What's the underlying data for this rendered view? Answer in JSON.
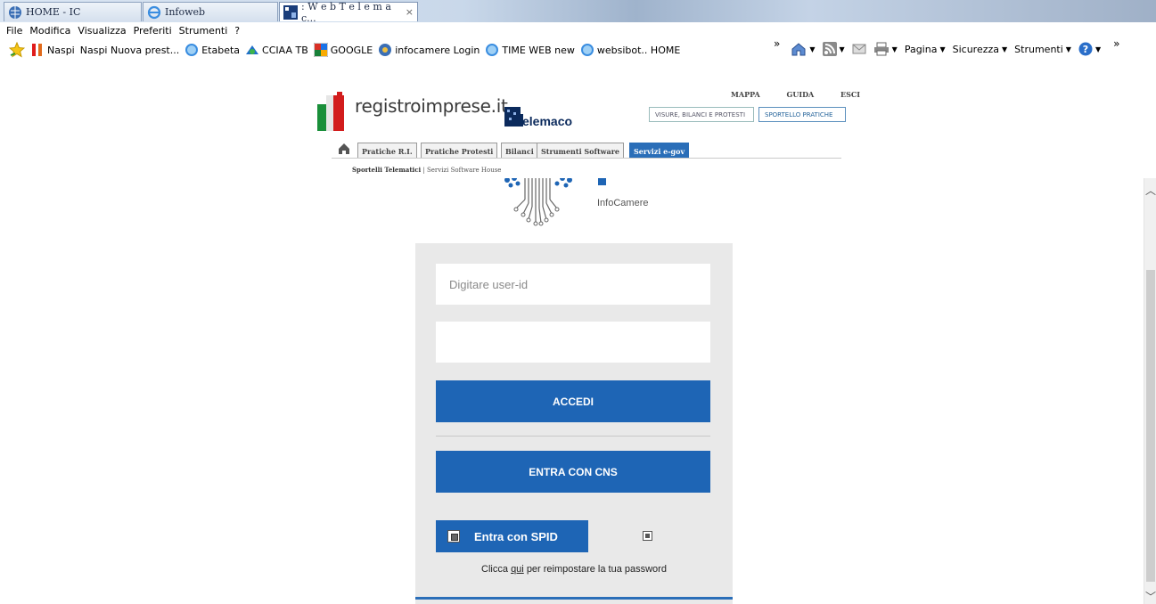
{
  "browser": {
    "tabs": [
      {
        "title": "HOME - IC",
        "active": false
      },
      {
        "title": "Infoweb",
        "active": false
      },
      {
        "title": ": W e b T e l e m a c...",
        "active": true
      }
    ],
    "tab_close": "×",
    "menu": [
      "File",
      "Modifica",
      "Visualizza",
      "Preferiti",
      "Strumenti",
      "?"
    ],
    "favorites": [
      "Naspi",
      "Naspi Nuova prest...",
      "Etabeta",
      "CCIAA TB",
      "GOOGLE",
      "infocamere Login",
      "TIME WEB new",
      "websibot.. HOME"
    ],
    "chevron": "»",
    "commands": {
      "page": "Pagina",
      "security": "Sicurezza",
      "tools": "Strumenti"
    }
  },
  "site": {
    "logo_text": "registroimprese.it",
    "telemaco_text": "elemaco",
    "top_links": [
      "MAPPA",
      "GUIDA",
      "ESCI"
    ],
    "switch": [
      "VISURE, BILANCI E PROTESTI",
      "SPORTELLO PRATICHE"
    ],
    "nav_tabs": [
      "Pratiche R.I.",
      "Pratiche Protesti",
      "Bilanci",
      "Strumenti Software",
      "Servizi e-gov"
    ],
    "subnav_primary": "Sportelli Telematici",
    "subnav_sep": "|",
    "subnav_secondary": "Servizi Software House"
  },
  "login": {
    "brand_text": "InfoCamere",
    "userid_placeholder": "Digitare user-id",
    "password_value": "",
    "accedi_label": "ACCEDI",
    "cns_label": "ENTRA CON CNS",
    "spid_label": "Entra con SPID",
    "reset_prefix": "Clicca",
    "reset_link": "qui",
    "reset_suffix": "per reimpostare la tua password"
  },
  "colors": {
    "accent": "#1e65b5",
    "panel": "#e9e9e9"
  }
}
